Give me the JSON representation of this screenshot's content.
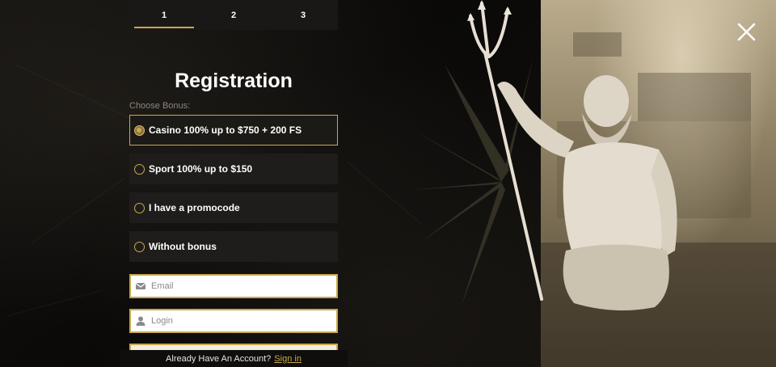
{
  "steps": [
    {
      "label": "1",
      "active": true
    },
    {
      "label": "2",
      "active": false
    },
    {
      "label": "3",
      "active": false
    }
  ],
  "title": "Registration",
  "choose_bonus_label": "Choose Bonus:",
  "bonus_options": [
    {
      "label": "Casino 100% up to $750 + 200 FS",
      "selected": true
    },
    {
      "label": "Sport 100% up to $150",
      "selected": false
    },
    {
      "label": "I have a promocode",
      "selected": false
    },
    {
      "label": "Without bonus",
      "selected": false
    }
  ],
  "fields": {
    "email": {
      "placeholder": "Email",
      "value": "",
      "icon": "envelope-icon"
    },
    "login": {
      "placeholder": "Login",
      "value": "",
      "icon": "user-icon"
    }
  },
  "footer": {
    "text": "Already Have An Account?",
    "link": "Sign in"
  },
  "close_icon": "close-icon",
  "colors": {
    "accent": "#c9a84c",
    "panel": "#1f1d1b",
    "background": "#0c0a08"
  }
}
